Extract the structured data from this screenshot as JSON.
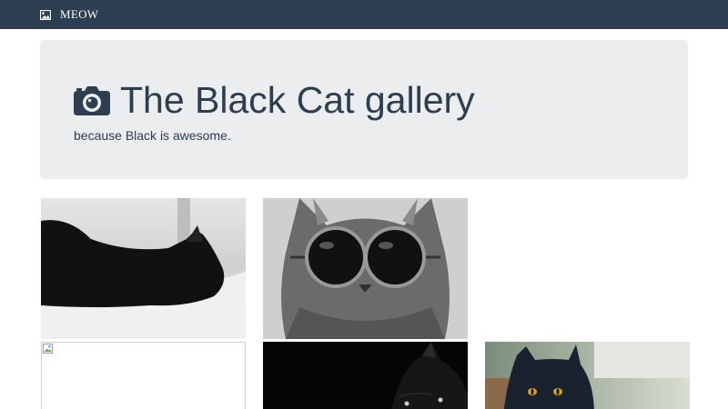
{
  "navbar": {
    "brand_label": "MEOW",
    "brand_icon": "image-icon"
  },
  "jumbotron": {
    "title": "The Black Cat gallery",
    "subtitle": "because Black is awesome.",
    "title_icon": "camera-icon"
  },
  "gallery": {
    "items": [
      {
        "subject": "black cat lying on white blanket",
        "broken": false
      },
      {
        "subject": "grey cat wearing round sunglasses",
        "broken": false
      },
      {
        "subject": "blank tile",
        "broken": false
      },
      {
        "subject": "broken image",
        "broken": true
      },
      {
        "subject": "black cat in dark",
        "broken": false
      },
      {
        "subject": "black cat with yellow eyes",
        "broken": false
      }
    ]
  },
  "colors": {
    "navbar": "#2c3e50",
    "jumbotron_bg": "#ecedef",
    "text": "#2c3e50"
  }
}
